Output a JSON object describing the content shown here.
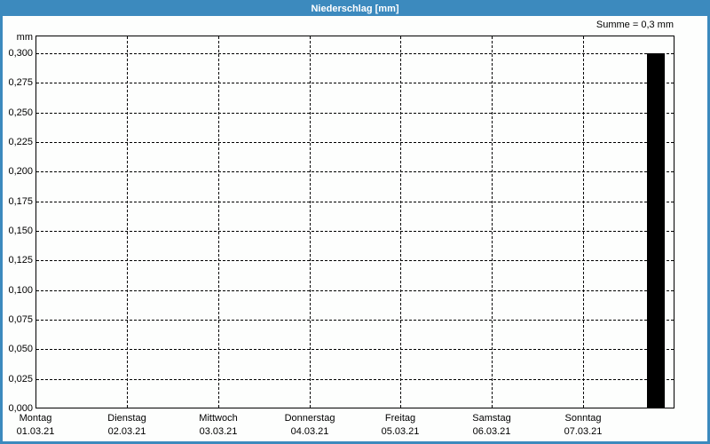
{
  "window": {
    "title": "Niederschlag [mm]"
  },
  "summary": {
    "sum_label": "Summe = 0,3 mm"
  },
  "colors": {
    "frame_blue": "#3c8abe",
    "titlebar_blue": "#3c8abe",
    "title_text": "#ffffff",
    "plot_frame": "#000000",
    "grid": "#000000",
    "bar": "#000000",
    "background": "#fdfefd"
  },
  "chart_data": {
    "type": "bar",
    "title": "Niederschlag [mm]",
    "unit_label": "mm",
    "ylabel": "mm",
    "ylim": [
      0,
      0.3
    ],
    "y_tick_step": 0.025,
    "y_tick_labels_top_to_bottom": [
      "0,300",
      "0,275",
      "0,250",
      "0,225",
      "0,200",
      "0,175",
      "0,150",
      "0,125",
      "0,100",
      "0,075",
      "0,050",
      "0,025",
      "0,000"
    ],
    "x_categories": [
      {
        "day": "Montag",
        "date": "01.03.21"
      },
      {
        "day": "Dienstag",
        "date": "02.03.21"
      },
      {
        "day": "Mittwoch",
        "date": "03.03.21"
      },
      {
        "day": "Donnerstag",
        "date": "04.03.21"
      },
      {
        "day": "Freitag",
        "date": "05.03.21"
      },
      {
        "day": "Samstag",
        "date": "06.03.21"
      },
      {
        "day": "Sonntag",
        "date": "07.03.21"
      }
    ],
    "grid": "dashed, horizontal every 0.025 mm, vertical at each day boundary",
    "legend": "none",
    "bars": [
      {
        "x0_frac": 0.9569,
        "x1_frac": 0.9847,
        "value": 0.3,
        "label": "precipitation event late Sonntag 07.03.21"
      }
    ],
    "sum_mm": 0.3
  }
}
